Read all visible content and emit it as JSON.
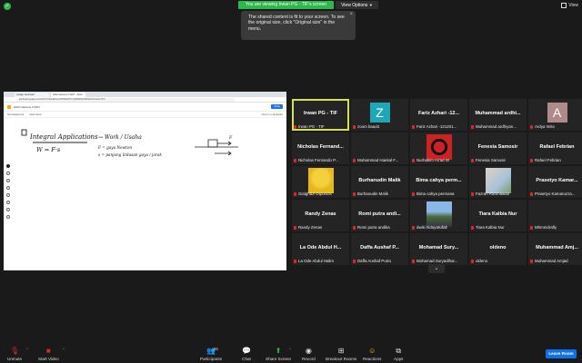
{
  "banner": {
    "viewing_text": "You are viewing Irwan PG - TIF's screen",
    "view_options_label": "View Options",
    "view_label": "View"
  },
  "tooltip": {
    "text": "The shared content is fit to your screen. To see the original size, click \"Original size\" in the menu."
  },
  "shared_screen": {
    "browser_tabs": [
      "Google Jamboard",
      "2022 Calculus 2 WST - Jamb..."
    ],
    "url": "jamboard.google.com/d/1KzYh3pmEOeLUhF5I6Gk9YX-QM5hk5pUR6CExL8/viewer?f=0",
    "jam_title": "2022 Calculus 2 WST",
    "toolbar_items": [
      "Set background",
      "Clear frame"
    ],
    "share_label": "Share",
    "open_label": "Open in a Jamboard",
    "note_title": "Integral Applications",
    "note_line1": "W = F·s",
    "note_arrow": "→ Work / Usaha",
    "note_f": "F = gaya   Newton",
    "note_s": "s = panjang lintasan gaya / jarak",
    "note_f_label": "F"
  },
  "participants_tiles": [
    {
      "big": "Irwan PG - TIF",
      "small": "Irwan PG - TIF",
      "active": true,
      "type": "text"
    },
    {
      "big": "",
      "small": "zoom baad4",
      "type": "avatar",
      "letter": "Z",
      "color": "#1ea7b6"
    },
    {
      "big": "Fariz Azhari -12...",
      "small": "Fariz Azhari -121201...",
      "type": "text"
    },
    {
      "big": "Muhammad ardhi...",
      "small": "Muhammad ardhiyan...",
      "type": "text"
    },
    {
      "big": "",
      "small": "Ardya Wira",
      "type": "avatar",
      "letter": "A",
      "color": "#b08a8a"
    },
    {
      "big": "Nicholas Fernand...",
      "small": "Nicholas Fernando P...",
      "type": "text"
    },
    {
      "big": "",
      "small": "Muhammad Haekal F...",
      "type": "dark"
    },
    {
      "big": "",
      "small": "Nurhakim As'ad W",
      "type": "photo-red"
    },
    {
      "big": "Fenesia Samosir",
      "small": "Fenesia Samosir",
      "type": "text"
    },
    {
      "big": "Rafael Febrian",
      "small": "Rafael Febrian",
      "type": "text"
    },
    {
      "big": "",
      "small": "Gialghazi Diponiza",
      "type": "photo-yellow"
    },
    {
      "big": "Burhanudin Malik",
      "small": "Burhanudin Malik",
      "type": "text"
    },
    {
      "big": "Bima cahya perm...",
      "small": "Bima cahya permana",
      "type": "text"
    },
    {
      "big": "",
      "small": "Fazrah Rahmawati",
      "type": "photo-paint"
    },
    {
      "big": "Prasetyo Kamar...",
      "small": "Prasetyo Kamaruzza...",
      "type": "text"
    },
    {
      "big": "Randy Zenas",
      "small": "Randy Zenas",
      "type": "text"
    },
    {
      "big": "Romi putra andi...",
      "small": "Romi putra andika",
      "type": "text"
    },
    {
      "big": "",
      "small": "dwiki hidayatullah",
      "type": "photo-group"
    },
    {
      "big": "Tiara Kalbia Nur",
      "small": "Tiara Kalbia Nur",
      "type": "text"
    },
    {
      "big": "",
      "small": "Mhmmdrafly",
      "type": "dark"
    },
    {
      "big": "La Ode Abdul H...",
      "small": "La Ode Abdul Halim",
      "type": "text"
    },
    {
      "big": "Daffa Aushaf P...",
      "small": "Daffa Aushaf Putra",
      "type": "text"
    },
    {
      "big": "Mohamad Sury...",
      "small": "Mohamad Suryadihar...",
      "type": "text"
    },
    {
      "big": "oldeno",
      "small": "oldeno",
      "type": "text"
    },
    {
      "big": "Muhammad Amj...",
      "small": "Muhammad Amjad",
      "type": "text"
    }
  ],
  "toolbar": {
    "unmute": "Unmute",
    "start_video": "Start Video",
    "participants": "Participants",
    "participants_count": "26",
    "chat": "Chat",
    "share_screen": "Share Screen",
    "record": "Record",
    "breakout": "Breakout Rooms",
    "reactions": "Reactions",
    "apps": "Apps",
    "leave": "Leave Room"
  },
  "colors": {
    "accent_green": "#2db84d",
    "active_border": "#d5e34a",
    "leave_blue": "#0e72ed",
    "muted_red": "#e02828"
  }
}
